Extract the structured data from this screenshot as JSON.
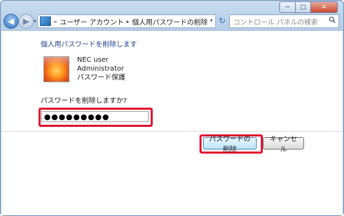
{
  "window": {
    "controls": {
      "minimize": "─",
      "maximize": "□",
      "close": "✕"
    }
  },
  "navbar": {
    "back_glyph": "◀",
    "forward_glyph": "▶",
    "dropdown_glyph": "▾",
    "breadcrumb": [
      "«",
      "ユーザー アカウント",
      "個人用パスワードの削除"
    ],
    "breadcrumb_separator": "▸",
    "refresh_glyph": "↻",
    "search_placeholder": "コントロール パネルの検索"
  },
  "content": {
    "heading": "個人用パスワードを削除します",
    "user": {
      "name": "NEC user",
      "role": "Administrator",
      "status": "パスワード保護"
    },
    "prompt": "パスワードを削除しますか?",
    "password_value": "●●●●●●●●●",
    "buttons": {
      "remove": "パスワードの削除",
      "cancel": "キャンセル"
    }
  },
  "colors": {
    "highlight": "#e2112d",
    "heading": "#1e3e8c"
  },
  "icons": {
    "avatar": "orange-flower-avatar",
    "address": "control-panel-icon",
    "search": "search-icon"
  }
}
